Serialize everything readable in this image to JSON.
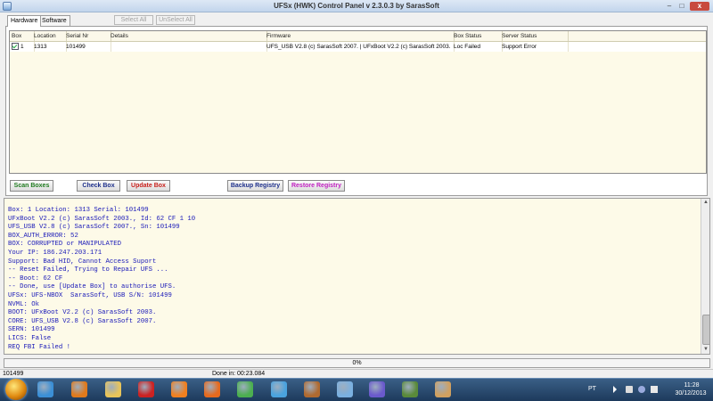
{
  "window": {
    "title": "UFSx (HWK) Control Panel v 2.3.0.3 by SarasSoft",
    "min_label": "–",
    "max_label": "□",
    "close_label": "x"
  },
  "tabs": [
    {
      "label": "Hardware",
      "active": true
    },
    {
      "label": "Software",
      "active": false
    }
  ],
  "top_buttons": {
    "select_all": "Select All",
    "unselect_all": "UnSelect All"
  },
  "grid": {
    "columns": [
      "Box",
      "Location",
      "Serial Nr",
      "Details",
      "Firmware",
      "Box Status",
      "Server Status"
    ],
    "rows": [
      {
        "checked": true,
        "box": "1",
        "location": "1313",
        "serial": "101499",
        "details": "",
        "firmware": "UFS_USB V2.8 (c) SarasSoft 2007. | UFxBoot V2.2 (c) SarasSoft 2003.",
        "box_status": "Loc Failed",
        "server_status": "Support Error"
      }
    ]
  },
  "action_buttons": {
    "scan": "Scan Boxes",
    "check": "Check Box",
    "update": "Update Box",
    "backup": "Backup Registry",
    "restore": "Restore Registry"
  },
  "log": [
    "Box: 1 Location: 1313 Serial: 101499",
    "UFxBoot V2.2 (c) SarasSoft 2003., Id: 62 CF 1 10",
    "UFS_USB V2.8 (c) SarasSoft 2007., Sn: 101499",
    "BOX_AUTH_ERROR: 52",
    "BOX: CORRUPTED or MANIPULATED",
    "Your IP: 186.247.203.171",
    "Support: Bad HID, Cannot Access Suport",
    "-- Reset Failed, Trying to Repair UFS ...",
    "-- Boot: 62 CF",
    "-- Done, use [Update Box] to authorise UFS.",
    "UFSx: UFS-NBOX  SarasSoft, USB S/N: 101499",
    "NVML: Ok",
    "BOOT: UFxBoot V2.2 (c) SarasSoft 2003.",
    "CORE: UFS_USB V2.8 (c) SarasSoft 2007.",
    "SERN: 101499",
    "LICS: False",
    "REQ FBI Failed !"
  ],
  "progress": {
    "label": "0%",
    "value": 0
  },
  "status": {
    "serial": "101499",
    "done": "Done in: 00:23.084"
  },
  "taskbar": {
    "language": "PT",
    "time": "11:28",
    "date": "30/12/2013"
  },
  "taskbar_icons": [
    {
      "name": "ie-icon",
      "color": "#3b8fd6"
    },
    {
      "name": "media-player-icon",
      "color": "#e07a1c"
    },
    {
      "name": "folder-icon",
      "color": "#e8c45a"
    },
    {
      "name": "flash-icon",
      "color": "#c22"
    },
    {
      "name": "avast-icon",
      "color": "#f08020"
    },
    {
      "name": "firefox-icon",
      "color": "#e66a1e"
    },
    {
      "name": "chrome-icon",
      "color": "#4caf50"
    },
    {
      "name": "tv-icon",
      "color": "#4aa3df"
    },
    {
      "name": "gimp-icon",
      "color": "#b06a30"
    },
    {
      "name": "notepad-icon",
      "color": "#7ab0e0"
    },
    {
      "name": "bluetooth-icon",
      "color": "#6a5acd"
    },
    {
      "name": "download-icon",
      "color": "#5a8a3a"
    },
    {
      "name": "ufs-icon",
      "color": "#d0a060"
    }
  ],
  "colors": {
    "log_text": "#1818b8",
    "grid_bg": "#fdfae8",
    "scan": "#1e7a1e",
    "update": "#c8201c",
    "restore": "#c020c0"
  }
}
